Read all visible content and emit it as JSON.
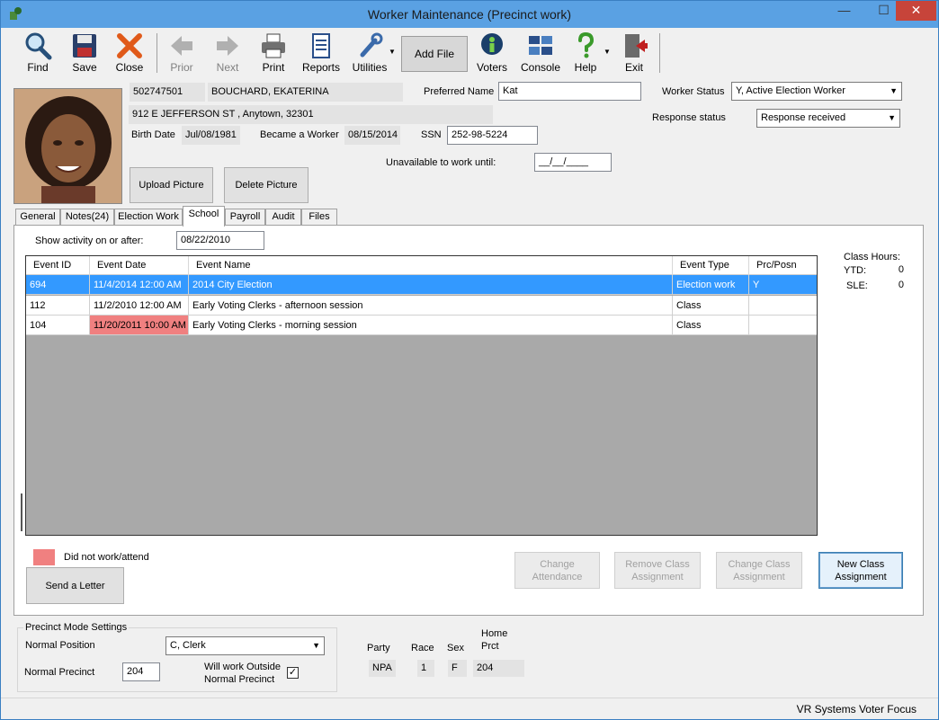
{
  "window": {
    "title": "Worker Maintenance (Precinct work)"
  },
  "toolbar": {
    "find": "Find",
    "save": "Save",
    "close": "Close",
    "prior": "Prior",
    "next": "Next",
    "print": "Print",
    "reports": "Reports",
    "utilities": "Utilities",
    "add_file": "Add File",
    "voters": "Voters",
    "console": "Console",
    "help": "Help",
    "exit": "Exit"
  },
  "worker": {
    "id": "502747501",
    "name": "BOUCHARD, EKATERINA",
    "address": "912 E JEFFERSON ST , Anytown, 32301",
    "birth_date_label": "Birth Date",
    "birth_date": "Jul/08/1981",
    "became_worker_label": "Became a Worker",
    "became_worker": "08/15/2014",
    "ssn_label": "SSN",
    "ssn": "252-98-5224",
    "preferred_name_label": "Preferred Name",
    "preferred_name": "Kat",
    "worker_status_label": "Worker Status",
    "worker_status": "Y, Active Election Worker",
    "response_status_label": "Response status",
    "response_status": "Response received",
    "unavailable_label": "Unavailable to work until:",
    "unavailable_value": "__/__/____"
  },
  "photo_buttons": {
    "upload": "Upload Picture",
    "delete": "Delete Picture"
  },
  "tabs": [
    "General",
    "Notes(24)",
    "Election Work",
    "School",
    "Payroll",
    "Audit",
    "Files"
  ],
  "school": {
    "show_activity_label": "Show activity on or after:",
    "show_activity_date": "08/22/2010",
    "columns": [
      "Event ID",
      "Event Date",
      "Event Name",
      "Event Type",
      "Prc/Posn"
    ],
    "rows": [
      {
        "id": "694",
        "date": "11/4/2014 12:00 AM",
        "name": "2014 City Election",
        "type": "Election work",
        "posn": "Y",
        "selected": true,
        "not_attended": false
      },
      {
        "id": "112",
        "date": "11/2/2010 12:00 AM",
        "name": "Early Voting Clerks - afternoon session",
        "type": "Class",
        "posn": "",
        "selected": false,
        "not_attended": false
      },
      {
        "id": "104",
        "date": "11/20/2011 10:00 AM",
        "name": "Early Voting Clerks - morning session",
        "type": "Class",
        "posn": "",
        "selected": false,
        "not_attended": true
      }
    ],
    "class_hours_label": "Class Hours:",
    "ytd_label": "YTD:",
    "ytd": "0",
    "sle_label": "SLE:",
    "sle": "0",
    "legend_label": "Did not work/attend",
    "legend_color": "#f08080",
    "selected_color": "#3399ff",
    "buttons": {
      "send_letter": "Send a Letter",
      "change_attendance": "Change Attendance",
      "remove_class": "Remove Class Assignment",
      "change_class": "Change Class Assignment",
      "new_class": "New Class Assignment"
    }
  },
  "precinct_mode": {
    "group_label": "Precinct Mode Settings",
    "normal_position_label": "Normal Position",
    "normal_position": "C, Clerk",
    "normal_precinct_label": "Normal Precinct",
    "normal_precinct": "204",
    "outside_label_1": "Will work Outside",
    "outside_label_2": "Normal Precinct",
    "outside_checked": true
  },
  "demographics": {
    "party_label": "Party",
    "party": "NPA",
    "race_label": "Race",
    "race": "1",
    "sex_label": "Sex",
    "sex": "F",
    "home_prct_label_1": "Home",
    "home_prct_label_2": "Prct",
    "home_prct": "204"
  },
  "status_bar": {
    "product": "VR Systems Voter Focus"
  }
}
